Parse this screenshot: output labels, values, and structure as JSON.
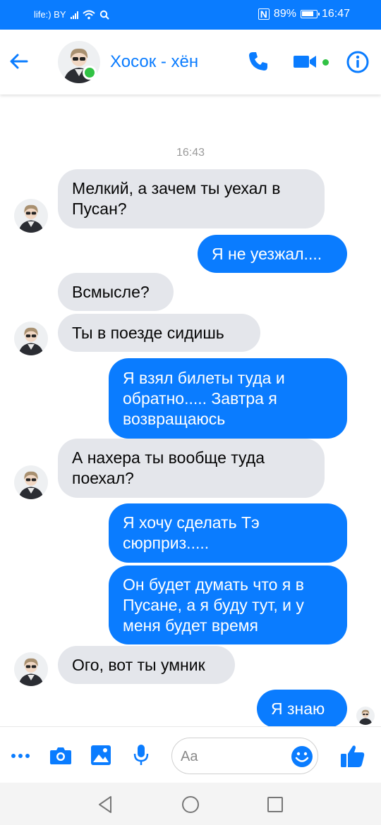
{
  "status_bar": {
    "carrier": "life:) BY",
    "battery": "89%",
    "time": "16:47"
  },
  "header": {
    "contact_name": "Хосок - хён"
  },
  "chat": {
    "timestamp": "16:43",
    "messages": [
      {
        "from": "them",
        "text": "Мелкий, а зачем ты уехал в Пусан?"
      },
      {
        "from": "me",
        "text": "Я не уезжал...."
      },
      {
        "from": "them",
        "text": "Всмысле?"
      },
      {
        "from": "them",
        "text": "Ты в поезде сидишь"
      },
      {
        "from": "me",
        "text": "Я взял билеты туда и обратно..... Завтра я возвращаюсь"
      },
      {
        "from": "them",
        "text": "А нахера ты вообще туда поехал?"
      },
      {
        "from": "me",
        "text": "Я хочу сделать Тэ сюрприз....."
      },
      {
        "from": "me",
        "text": "Он будет думать что я в Пусане, а я буду тут, и у меня будет время"
      },
      {
        "from": "them",
        "text": "Ого, вот ты умник"
      },
      {
        "from": "me",
        "text": "Я знаю"
      }
    ]
  },
  "composer": {
    "placeholder": "Aa"
  },
  "colors": {
    "accent": "#0a7cff",
    "incoming_bubble": "#e4e6eb",
    "online": "#31c244"
  },
  "icons": [
    "back-arrow-icon",
    "phone-icon",
    "video-camera-icon",
    "info-icon",
    "more-icon",
    "camera-icon",
    "image-icon",
    "microphone-icon",
    "emoji-icon",
    "like-icon",
    "nav-back-icon",
    "nav-home-icon",
    "nav-recents-icon"
  ]
}
